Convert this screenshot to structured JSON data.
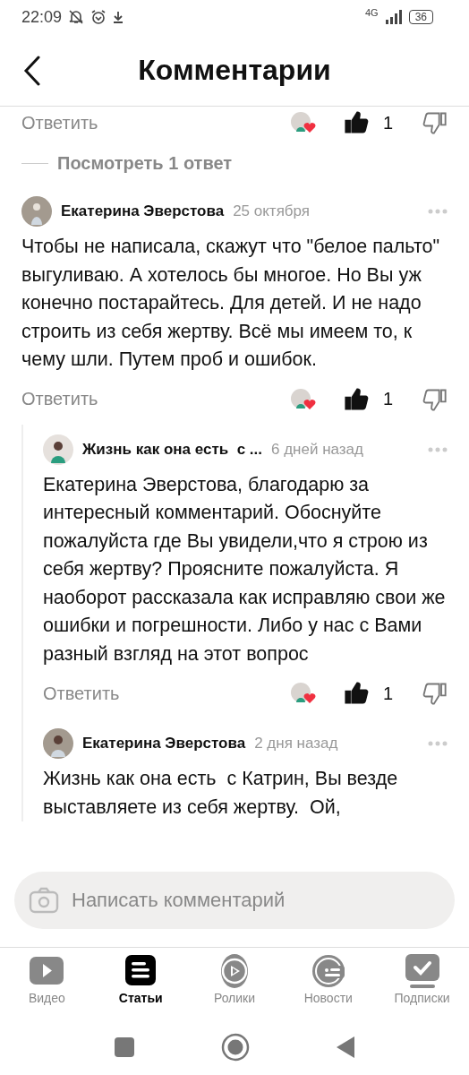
{
  "status_bar": {
    "time": "22:09",
    "network": "4G",
    "battery": "36"
  },
  "header": {
    "title": "Комментарии"
  },
  "top_actions": {
    "reply": "Ответить",
    "author_liked": true,
    "liked": true,
    "likes": "1"
  },
  "view_replies": "Посмотреть 1 ответ",
  "thread": {
    "author": "Екатерина Эверстова",
    "date": "25 октября",
    "text": "Чтобы не написала, скажут что \"белое пальто\" выгуливаю. А хотелось бы многое. Но Вы уж конечно постарайтесь. Для детей. И не надо строить из себя жертву. Всё мы имеем то, к чему шли. Путем проб и ошибок.",
    "actions": {
      "reply": "Ответить",
      "author_liked": true,
      "liked": true,
      "likes": "1"
    },
    "replies": [
      {
        "author": "Жизнь как она есть  с ...",
        "date": "6 дней назад",
        "text": "Екатерина Эверстова, благодарю за интересный комментарий. Обоснуйте пожалуйста где Вы увидели,что я строю из себя жертву? Проясните пожалуйста. Я наоборот рассказала как исправляю свои же ошибки и погрешности. Либо у нас с Вами разный взгляд на этот вопрос",
        "actions": {
          "reply": "Ответить",
          "author_liked": true,
          "liked": true,
          "likes": "1"
        }
      },
      {
        "author": "Екатерина Эверстова",
        "date": "2 дня назад",
        "text": "Жизнь как она есть  с Катрин, Вы везде выставляете из себя жертву.  Ой,"
      }
    ]
  },
  "comment_input": {
    "placeholder": "Написать комментарий"
  },
  "tabs": [
    {
      "kind": "video",
      "label": "Видео",
      "selected": false
    },
    {
      "kind": "articles",
      "label": "Статьи",
      "selected": true
    },
    {
      "kind": "shorts",
      "label": "Ролики",
      "selected": false
    },
    {
      "kind": "news",
      "label": "Новости",
      "selected": false
    },
    {
      "kind": "subscriptions",
      "label": "Подписки",
      "selected": false
    }
  ]
}
